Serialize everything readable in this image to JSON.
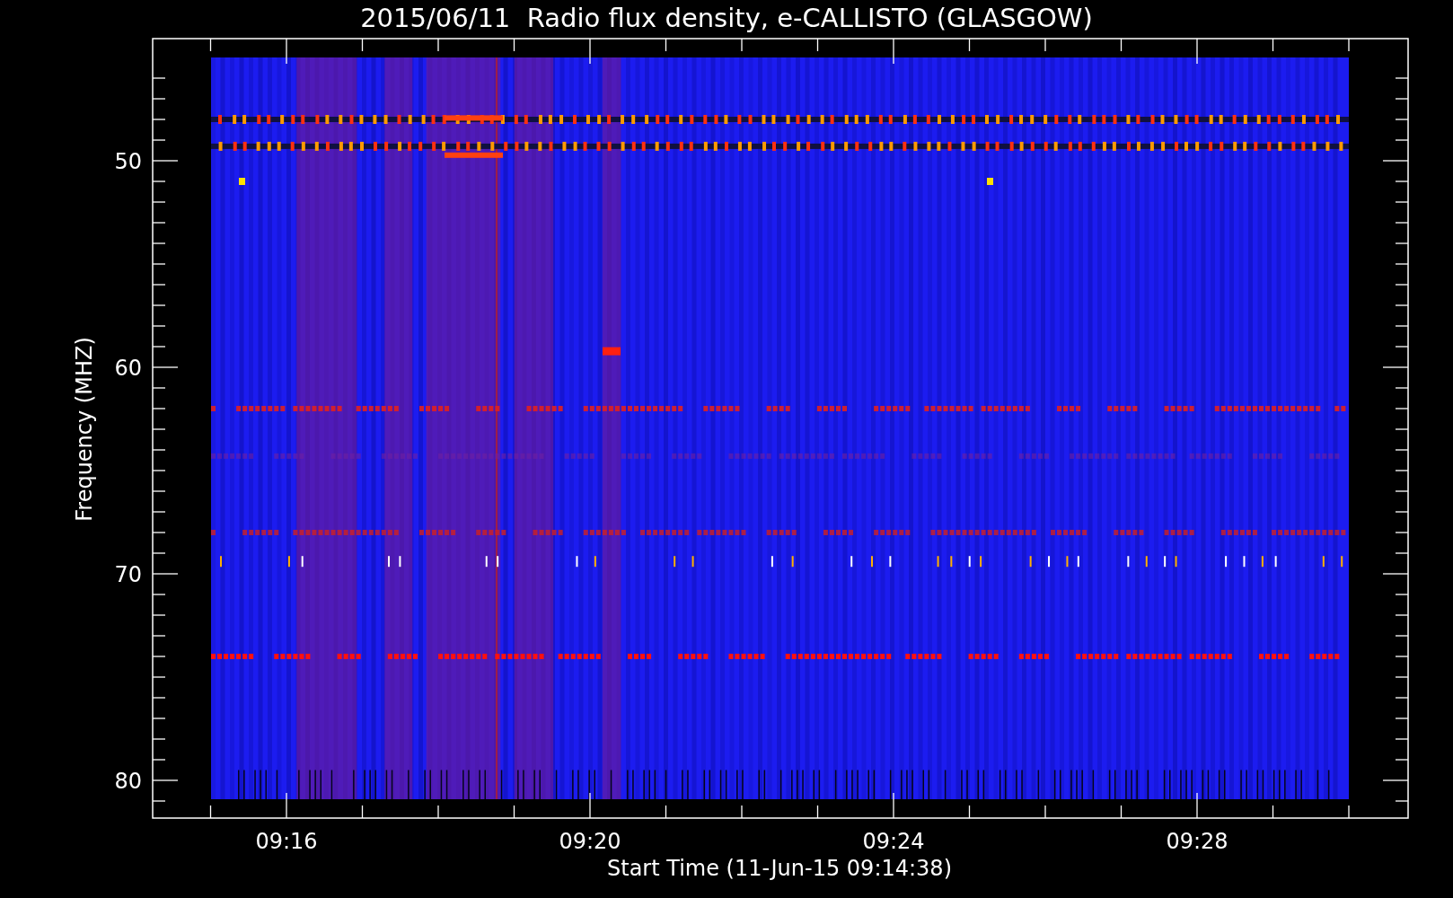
{
  "title": "2015/06/11  Radio flux density, e-CALLISTO (GLASGOW)",
  "plot": {
    "ylabel": "Frequency (MHZ)",
    "xlabel": "Start Time (11-Jun-15 09:14:38)",
    "yticks": [
      "50",
      "60",
      "70",
      "80"
    ],
    "xticks": [
      "09:16",
      "09:20",
      "09:24",
      "09:28"
    ]
  }
}
